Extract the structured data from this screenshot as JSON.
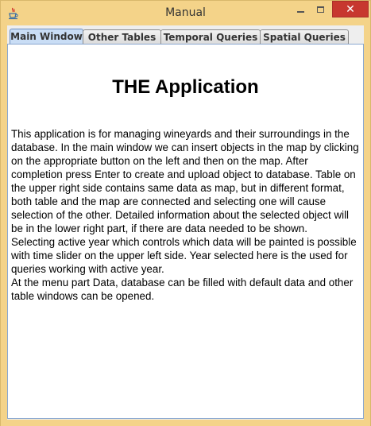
{
  "window": {
    "title": "Manual",
    "close_symbol": "✕"
  },
  "tabs": [
    {
      "label": "Main Window",
      "active": true
    },
    {
      "label": "Other Tables",
      "active": false
    },
    {
      "label": "Temporal Queries",
      "active": false
    },
    {
      "label": "Spatial Queries",
      "active": false
    }
  ],
  "document": {
    "heading": "THE Application",
    "paragraphs": [
      "This application is for managing wineyards and their surroundings in the database. In the main window we can insert objects in the map by clicking on the appropriate button on the left and then on the map. After completion press Enter to create and upload object to database. Table on the upper right side contains same data as map, but in different format, both table and the map are connected and selecting one will cause selection of the other. Detailed information about the selected object will be in the lower right part, if there are data needed to be shown.",
      "Selecting active year which controls which data will be painted is possible with time slider on the upper left side. Year selected here is the used for queries working with active year.",
      "At the menu part Data, database can be filled with default data and other table windows can be opened."
    ]
  },
  "colors": {
    "frame": "#f4d389",
    "close_button": "#c7372f",
    "active_tab": "#c9ddf5"
  },
  "icons": {
    "app": "java-cup-icon",
    "minimize": "minimize-icon",
    "maximize": "maximize-icon",
    "close": "close-icon"
  }
}
